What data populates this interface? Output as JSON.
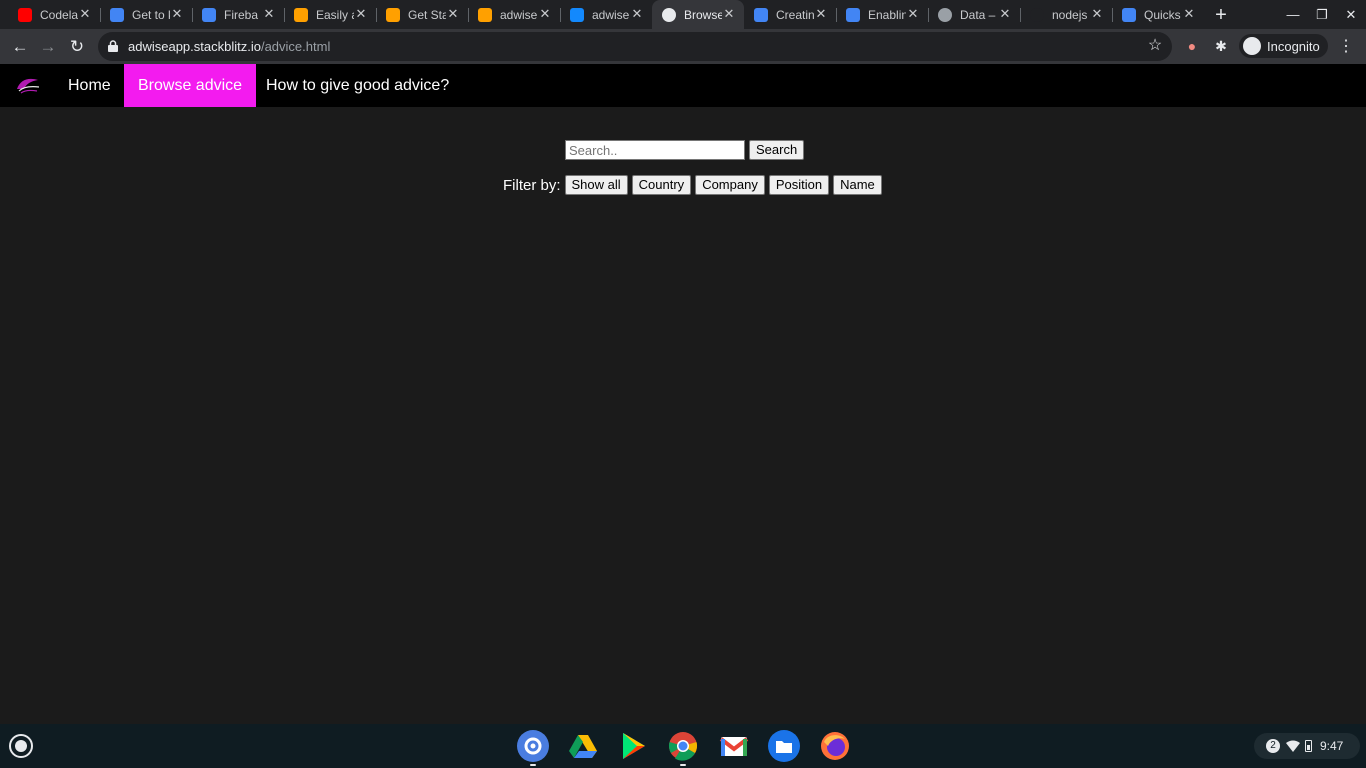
{
  "browser": {
    "tabs": [
      {
        "title": "Codela",
        "favicon_color": "#ff0000",
        "icon": "youtube-icon"
      },
      {
        "title": "Get to k",
        "favicon_color": "#4285f4",
        "icon": "google-icon"
      },
      {
        "title": "Fireba",
        "favicon_color": "#4285f4",
        "icon": "google-icon"
      },
      {
        "title": "Easily a",
        "favicon_color": "#ffa000",
        "icon": "firebase-icon"
      },
      {
        "title": "Get Sta",
        "favicon_color": "#ffa000",
        "icon": "firebase-icon"
      },
      {
        "title": "adwise",
        "favicon_color": "#ffa000",
        "icon": "firebase-icon"
      },
      {
        "title": "adwise",
        "favicon_color": "#1389fd",
        "icon": "stackblitz-icon"
      },
      {
        "title": "Browse",
        "favicon_color": "#e8eaed",
        "icon": "loading-clock-icon"
      },
      {
        "title": "Creatin",
        "favicon_color": "#4285f4",
        "icon": "google-cloud-icon"
      },
      {
        "title": "Enablin",
        "favicon_color": "#4285f4",
        "icon": "google-cloud-icon"
      },
      {
        "title": "Data –",
        "favicon_color": "#9aa0a6",
        "icon": "gear-icon"
      },
      {
        "title": "nodejs",
        "favicon_color": "#202124",
        "icon": "github-icon"
      },
      {
        "title": "Quicks",
        "favicon_color": "#4285f4",
        "icon": "google-cloud-icon"
      }
    ],
    "active_tab_index": 7,
    "url_host": "adwiseapp.stackblitz.io",
    "url_path": "/advice.html",
    "profile_label": "Incognito"
  },
  "site": {
    "nav": {
      "home": "Home",
      "browse": "Browse advice",
      "howto": "How to give good advice?"
    },
    "search": {
      "placeholder": "Search..",
      "button": "Search"
    },
    "filter": {
      "label": "Filter by:",
      "buttons": [
        "Show all",
        "Country",
        "Company",
        "Position",
        "Name"
      ]
    },
    "accent_color": "#f31bef"
  },
  "shelf": {
    "apps": [
      "settings-icon",
      "google-drive-icon",
      "play-store-icon",
      "chrome-icon",
      "gmail-icon",
      "files-icon",
      "firefox-icon"
    ],
    "notification_count": "2",
    "time": "9:47"
  }
}
